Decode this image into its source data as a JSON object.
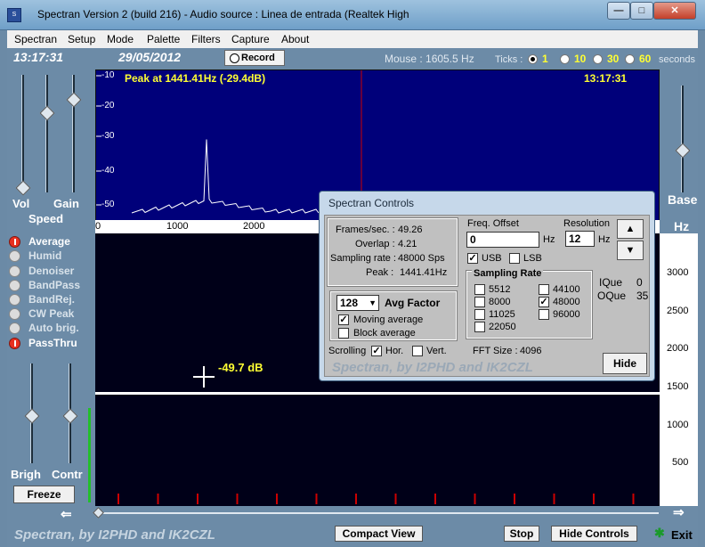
{
  "window": {
    "title": "Spectran Version 2 (build 216) - Audio source :  Linea de entrada (Realtek High",
    "app_icon": "spectran-app-icon",
    "minimize": "—",
    "maximize": "□",
    "close": "✕"
  },
  "menu": [
    "Spectran",
    "Setup",
    "Mode",
    "Palette",
    "Filters",
    "Capture",
    "About"
  ],
  "header": {
    "time": "13:17:31",
    "date": "29/05/2012",
    "record_label": "Record",
    "mouse": "Mouse :  1605.5 Hz",
    "ticks_label": "Ticks :",
    "ticks_options": [
      "1",
      "10",
      "30",
      "60"
    ],
    "ticks_selected": "1",
    "seconds_label": "seconds"
  },
  "left_panel": {
    "vol_label": "Vol",
    "gain_label": "Gain",
    "speed_label": "Speed",
    "options": [
      {
        "label": "Average",
        "on": true
      },
      {
        "label": "Humid",
        "on": false
      },
      {
        "label": "Denoiser",
        "on": false
      },
      {
        "label": "BandPass",
        "on": false
      },
      {
        "label": "BandRej.",
        "on": false
      },
      {
        "label": "CW Peak",
        "on": false
      },
      {
        "label": "Auto brig.",
        "on": false
      },
      {
        "label": "PassThru",
        "on": true
      }
    ],
    "brigh_label": "Brigh",
    "contr_label": "Contr",
    "freeze_label": "Freeze"
  },
  "right_panel": {
    "base_label": "Base",
    "hz_label": "Hz",
    "scale_ticks": [
      "3000",
      "2500",
      "2000",
      "1500",
      "1000",
      "500"
    ]
  },
  "spectrum": {
    "peak_text": "Peak at  1441.41Hz (-29.4dB)",
    "time": "13:17:31",
    "db_ticks": [
      "-10",
      "-20",
      "-30",
      "-40",
      "-50"
    ],
    "freq_ticks": [
      "0",
      "1000",
      "2000"
    ],
    "cursor_readout": "-49.7 dB",
    "cursor_freq_hz": 1605.5,
    "peak_freq_hz": 1441.41,
    "peak_db": -29.4
  },
  "dialog": {
    "title": "Spectran Controls",
    "frames_label": "Frames/sec. :",
    "frames_value": "49.26",
    "overlap_label": "Overlap :",
    "overlap_value": "4.21",
    "sampling_label": "Sampling rate :",
    "sampling_value": "48000 Sps",
    "peak_label": "Peak :",
    "peak_value": "1441.41Hz",
    "avg_value": "128",
    "avg_label": "Avg Factor",
    "moving_avg_label": "Moving average",
    "moving_avg_checked": true,
    "block_avg_label": "Block average",
    "block_avg_checked": false,
    "scrolling_label": "Scrolling",
    "hor_label": "Hor.",
    "hor_checked": true,
    "vert_label": "Vert.",
    "vert_checked": false,
    "freq_offset_label": "Freq. Offset",
    "freq_offset_value": "0",
    "hz_unit": "Hz",
    "resolution_label": "Resolution",
    "resolution_value": "12",
    "usb_label": "USB",
    "usb_checked": true,
    "lsb_label": "LSB",
    "lsb_checked": false,
    "sampling_rate_title": "Sampling Rate",
    "rates_col1": [
      "5512",
      "8000",
      "11025",
      "22050"
    ],
    "rates_col2": [
      "44100",
      "48000",
      "96000"
    ],
    "rate_selected": "48000",
    "ique_label": "IQue",
    "ique_value": "0",
    "oque_label": "OQue",
    "oque_value": "35",
    "fft_label": "FFT Size :",
    "fft_value": "4096",
    "footer_text": "Spectran, by I2PHD and IK2CZL",
    "hide_label": "Hide"
  },
  "footer": {
    "credit": "Spectran, by I2PHD and IK2CZL",
    "compact_view_label": "Compact View",
    "stop_label": "Stop",
    "hide_controls_label": "Hide Controls",
    "exit_label": "Exit",
    "exit_icon": "running-man-icon"
  },
  "colors": {
    "spectrum_bg": "#00007a",
    "peak_text": "#ffff33",
    "cursor_line": "#cc0000",
    "option_on": "#e83020"
  }
}
